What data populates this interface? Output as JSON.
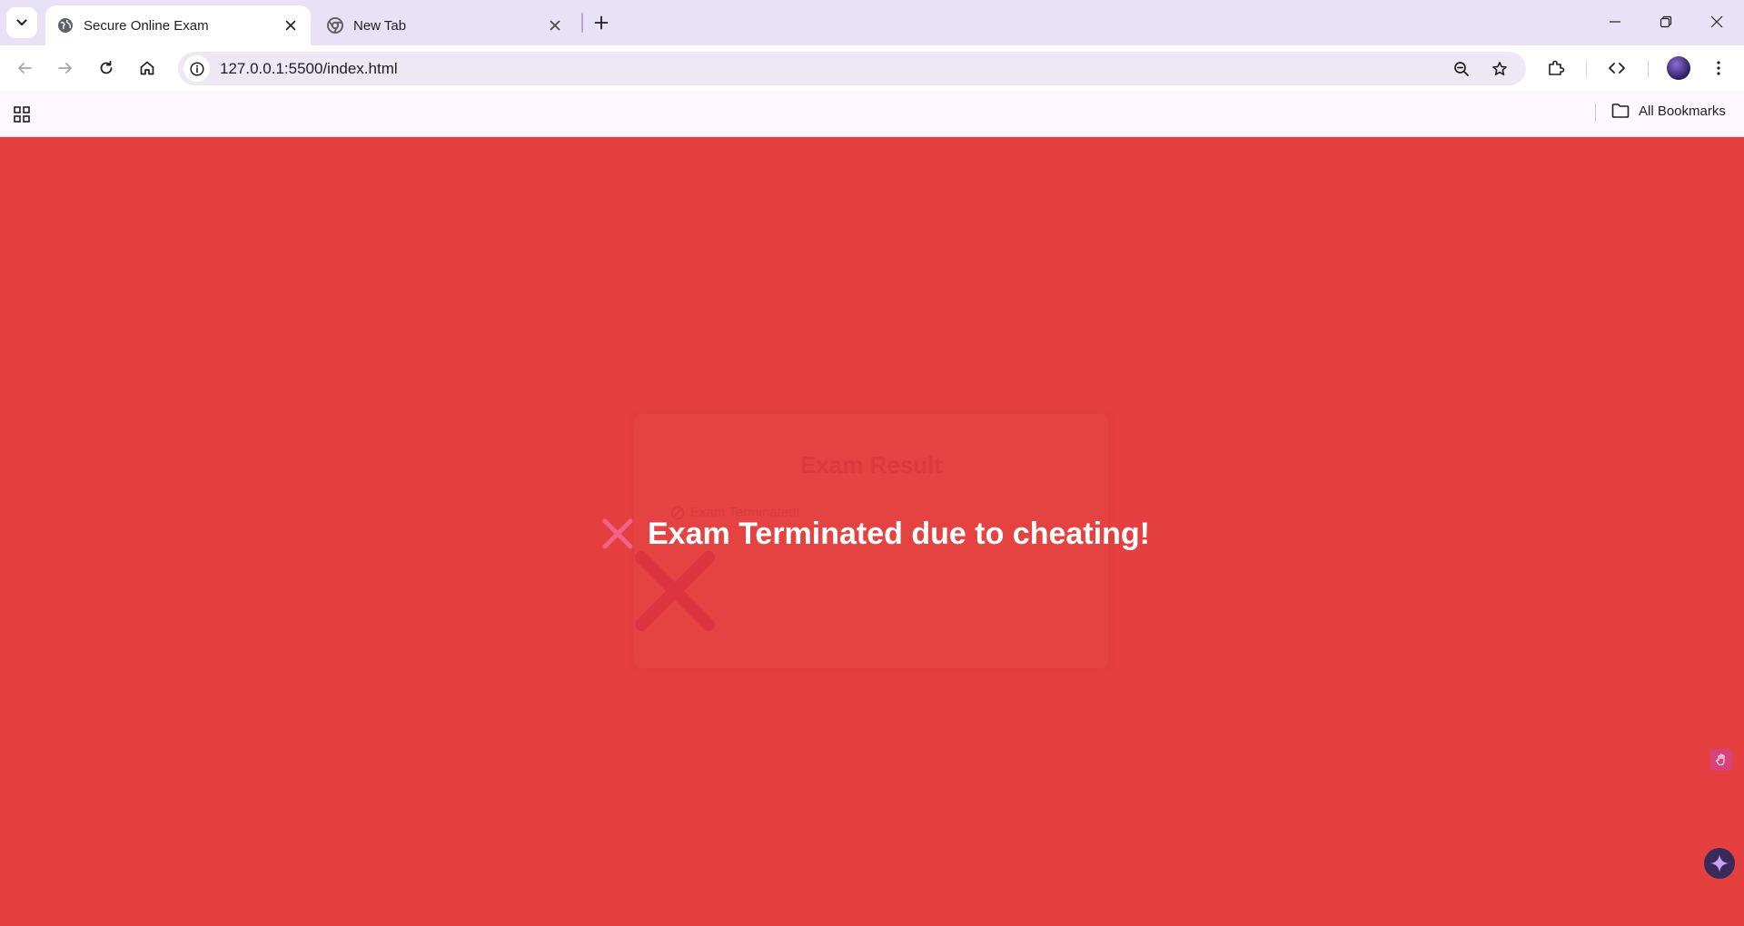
{
  "browser": {
    "tabs": [
      {
        "title": "Secure Online Exam",
        "active": true,
        "favicon": "globe-icon"
      },
      {
        "title": "New Tab",
        "active": false,
        "favicon": "chrome-icon"
      }
    ],
    "address_bar": {
      "url": "127.0.0.1:5500/index.html"
    },
    "bookmarks": {
      "all_bookmarks_label": "All Bookmarks"
    }
  },
  "page": {
    "background_color": "#e5403f",
    "result_card": {
      "title": "Exam Result",
      "status_text": "Exam Terminated!"
    },
    "overlay_message": "Exam Terminated due to cheating!"
  }
}
